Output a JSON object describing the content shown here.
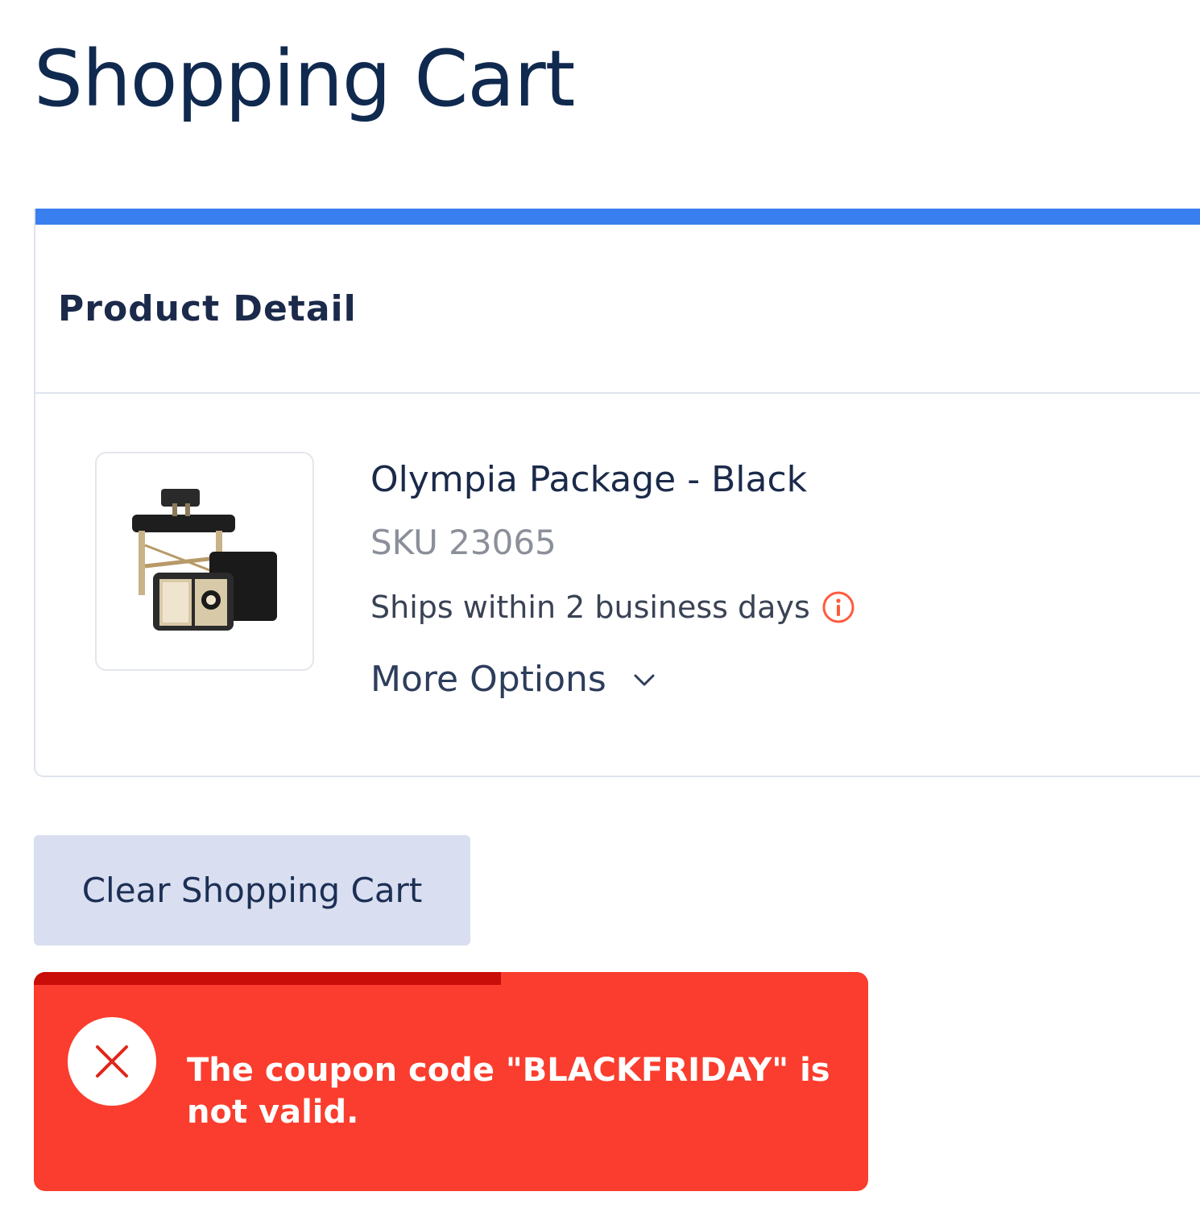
{
  "page": {
    "title": "Shopping Cart"
  },
  "cart": {
    "section_heading": "Product Detail",
    "items": [
      {
        "name": "Olympia Package - Black",
        "sku": "SKU 23065",
        "shipping": "Ships within 2 business days",
        "more_options_label": "More Options"
      }
    ],
    "clear_button_label": "Clear Shopping Cart"
  },
  "toast": {
    "message": "The coupon code \"BLACKFRIDAY\" is not valid.",
    "progress": 0.56
  },
  "icons": {
    "info": "info-icon",
    "chevron": "chevron-down-icon",
    "close": "close-icon"
  },
  "colors": {
    "accent": "#3a7ff0",
    "error": "#fa3d2e",
    "error_progress": "#c90d09",
    "info_icon": "#ff5a3c",
    "button_bg": "#d9dff0"
  }
}
